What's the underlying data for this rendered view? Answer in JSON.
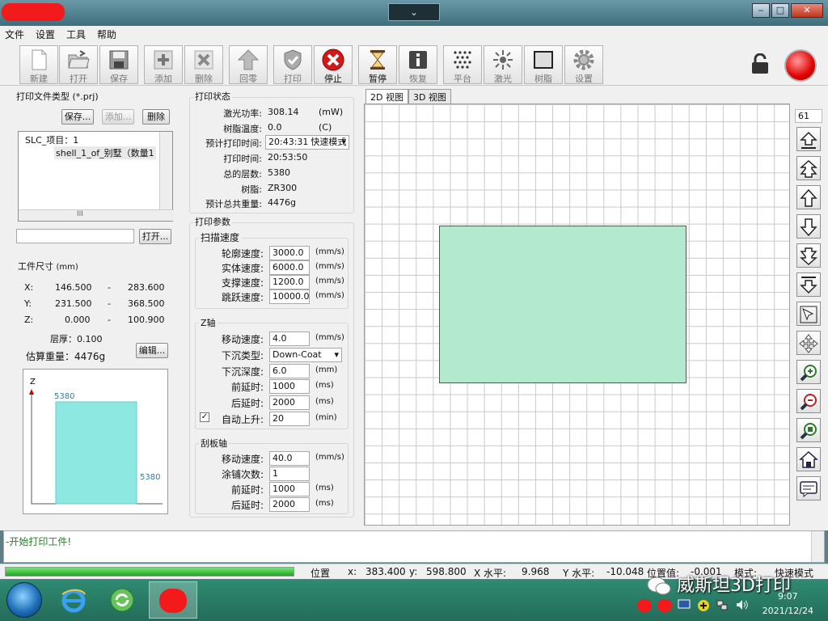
{
  "window": {
    "center_button": "⌄",
    "minimize": "‒",
    "maximize": "□",
    "close": "✕"
  },
  "menu": [
    "文件",
    "设置",
    "工具",
    "帮助"
  ],
  "toolbar": [
    {
      "label": "新建",
      "icon": "new-file-icon"
    },
    {
      "label": "打开",
      "icon": "open-folder-icon"
    },
    {
      "label": "保存",
      "icon": "save-disk-icon"
    },
    {
      "label": "添加",
      "icon": "add-icon"
    },
    {
      "label": "删除",
      "icon": "delete-icon"
    },
    {
      "label": "回零",
      "icon": "home-arrow-icon"
    },
    {
      "label": "打印",
      "icon": "shield-check-icon"
    },
    {
      "label": "停止",
      "icon": "stop-x-icon"
    },
    {
      "label": "暂停",
      "icon": "hourglass-icon"
    },
    {
      "label": "恢复",
      "icon": "info-icon"
    },
    {
      "label": "平台",
      "icon": "platform-dots-icon"
    },
    {
      "label": "激光",
      "icon": "laser-icon"
    },
    {
      "label": "树脂",
      "icon": "resin-icon"
    },
    {
      "label": "设置",
      "icon": "gear-icon"
    }
  ],
  "left": {
    "file_type_title": "打印文件类型 (*.prj)",
    "save_btn": "保存...",
    "add_btn": "添加...",
    "delete_btn": "删除",
    "tree_root": "SLC_项目：1",
    "tree_child": "shell_1_of_别墅（数量1",
    "hscroll_mark": "III",
    "open_btn": "打开...",
    "open_input": "",
    "size_title": "工件尺寸",
    "size_unit": "(mm)",
    "x_label": "X:",
    "x_min": "146.500",
    "x_max": "283.600",
    "y_label": "Y:",
    "y_min": "231.500",
    "y_max": "368.500",
    "z_label": "Z:",
    "z_min": "0.000",
    "z_max": "100.900",
    "dash": "-",
    "layer_label": "层厚：",
    "layer_value": "0.100",
    "weight_label": "估算重量：",
    "weight_value": "4476g",
    "edit_btn": "编辑..."
  },
  "chart_data": {
    "type": "bar",
    "categories": [
      ""
    ],
    "values": [
      5380
    ],
    "ylabel": "Z",
    "top_label": "5380",
    "side_label": "5380",
    "ylim": [
      0,
      5380
    ]
  },
  "status_panel": {
    "title": "打印状态",
    "rows": [
      {
        "label": "激光功率:",
        "value": "308.14",
        "unit": "(mW)"
      },
      {
        "label": "树脂温度:",
        "value": "0.0",
        "unit": "(C)"
      },
      {
        "label": "预计打印时间:",
        "value": "20:43:31",
        "extra": "快速模式"
      },
      {
        "label": "打印时间:",
        "value": "20:53:50"
      },
      {
        "label": "总的层数:",
        "value": "5380"
      },
      {
        "label": "树脂:",
        "value": "ZR300"
      },
      {
        "label": "预计总共重量:",
        "value": "4476g"
      }
    ]
  },
  "params": {
    "title": "打印参数",
    "scan_title": "扫描速度",
    "scan": [
      {
        "label": "轮廓速度:",
        "value": "3000.0",
        "unit": "(mm/s)"
      },
      {
        "label": "实体速度:",
        "value": "6000.0",
        "unit": "(mm/s)"
      },
      {
        "label": "支撑速度:",
        "value": "1200.0",
        "unit": "(mm/s)"
      },
      {
        "label": "跳跃速度:",
        "value": "10000.0",
        "unit": "(mm/s)"
      }
    ],
    "z_title": "Z轴",
    "z": [
      {
        "label": "移动速度:",
        "value": "4.0",
        "unit": "(mm/s)"
      },
      {
        "label": "下沉类型:",
        "value": "Down-Coat",
        "unit": ""
      },
      {
        "label": "下沉深度:",
        "value": "6.0",
        "unit": "(mm)"
      },
      {
        "label": "前延时:",
        "value": "1000",
        "unit": "(ms)"
      },
      {
        "label": "后延时:",
        "value": "2000",
        "unit": "(ms)"
      },
      {
        "label": "自动上升:",
        "value": "20",
        "unit": "(min)"
      }
    ],
    "auto_rise_checked": true,
    "scraper_title": "刮板轴",
    "scraper": [
      {
        "label": "移动速度:",
        "value": "40.0",
        "unit": "(mm/s)"
      },
      {
        "label": "涂铺次数:",
        "value": "1",
        "unit": ""
      },
      {
        "label": "前延时:",
        "value": "1000",
        "unit": "(ms)"
      },
      {
        "label": "后延时:",
        "value": "2000",
        "unit": "(ms)"
      }
    ]
  },
  "view": {
    "tab_2d": "2D 视图",
    "tab_3d": "3D 视图",
    "layer_value": "61"
  },
  "log": {
    "text": "-开始打印工件!"
  },
  "statusbar": {
    "progress": 1.0,
    "pos_label": "位置",
    "x_label": "x:",
    "x_value": "383.400",
    "y_label": "y:",
    "y_value": "598.800",
    "xh_label": "X 水平:",
    "xh_value": "9.968",
    "yh_label": "Y 水平:",
    "yh_value": "-10.048",
    "pv_label": "位置值:",
    "pv_value": "-0.001",
    "mode_label": "模式:",
    "mode_value": "快速模式"
  },
  "taskbar": {
    "watermark": "威斯坦3D打印",
    "time": "9:07",
    "date": "2021/12/24"
  },
  "colors": {
    "part_fill": "#b3e9cd",
    "bar_fill": "#8ee8e2",
    "log_text": "#2b7b2b",
    "stop_red": "#d01a1a"
  }
}
